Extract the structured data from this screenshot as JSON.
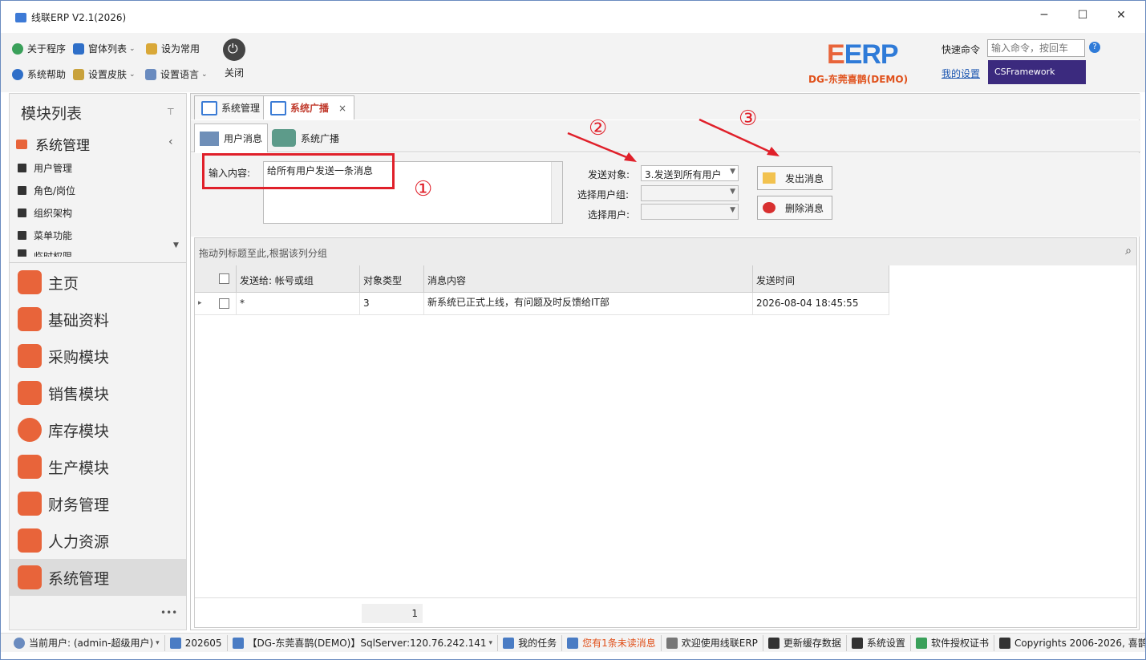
{
  "window": {
    "title": "线联ERP V2.1(2026)",
    "minimize": "─",
    "maximize": "☐",
    "close": "✕"
  },
  "ribbon": {
    "about": "关于程序",
    "form_list": "窗体列表",
    "set_common": "设为常用",
    "help": "系统帮助",
    "skin": "设置皮肤",
    "language": "设置语言",
    "close_label": "关闭",
    "logo_text": "ERP",
    "company": "DG-东莞喜鹊(DEMO)",
    "quick_cmd_label": "快速命令",
    "quick_cmd_placeholder": "输入命令，按回车",
    "my_settings": "我的设置",
    "framework_badge": "CSFramework"
  },
  "sidebar": {
    "title": "模块列表",
    "section": "系统管理",
    "items": [
      "用户管理",
      "角色/岗位",
      "组织架构",
      "菜单功能",
      "临时权限"
    ],
    "modules": [
      "主页",
      "基础资料",
      "采购模块",
      "销售模块",
      "库存模块",
      "生产模块",
      "财务管理",
      "人力资源",
      "系统管理"
    ],
    "more": "•••"
  },
  "tabs": [
    {
      "label": "系统管理"
    },
    {
      "label": "系统广播",
      "close": "×"
    }
  ],
  "subtabs": [
    "用户消息",
    "系统广播"
  ],
  "form": {
    "content_label": "输入内容:",
    "content_value": "给所有用户发送一条消息",
    "send_to_label": "发送对象:",
    "send_to_value": "3.发送到所有用户",
    "group_label": "选择用户组:",
    "user_label": "选择用户:",
    "send_button": "发出消息",
    "delete_button": "删除消息"
  },
  "annotations": [
    "①",
    "②",
    "③"
  ],
  "grid": {
    "group_hint": "拖动列标题至此,根据该列分组",
    "columns": [
      "发送给: 帐号或组",
      "对象类型",
      "消息内容",
      "发送时间"
    ],
    "rows": [
      {
        "to": "*",
        "type": "3",
        "content": "新系统已正式上线，有问题及时反馈给IT部",
        "time": "2026-08-04 18:45:55"
      }
    ],
    "page": "1"
  },
  "status": {
    "user": "当前用户: (admin-超级用户)",
    "period": "202605",
    "db": "【DG-东莞喜鹊(DEMO)】SqlServer:120.76.242.141",
    "tasks": "我的任务",
    "unread": "您有1条未读消息",
    "welcome": "欢迎使用线联ERP",
    "refresh": "更新缓存数据",
    "settings": "系统设置",
    "license": "软件授权证书",
    "copyright": "Copyrights 2006-2026, 喜鹊"
  },
  "colors": {
    "accent": "#3a7bd5",
    "alert": "#e0202a",
    "module_icon": "#e8643a",
    "unread": "#e0501a"
  }
}
